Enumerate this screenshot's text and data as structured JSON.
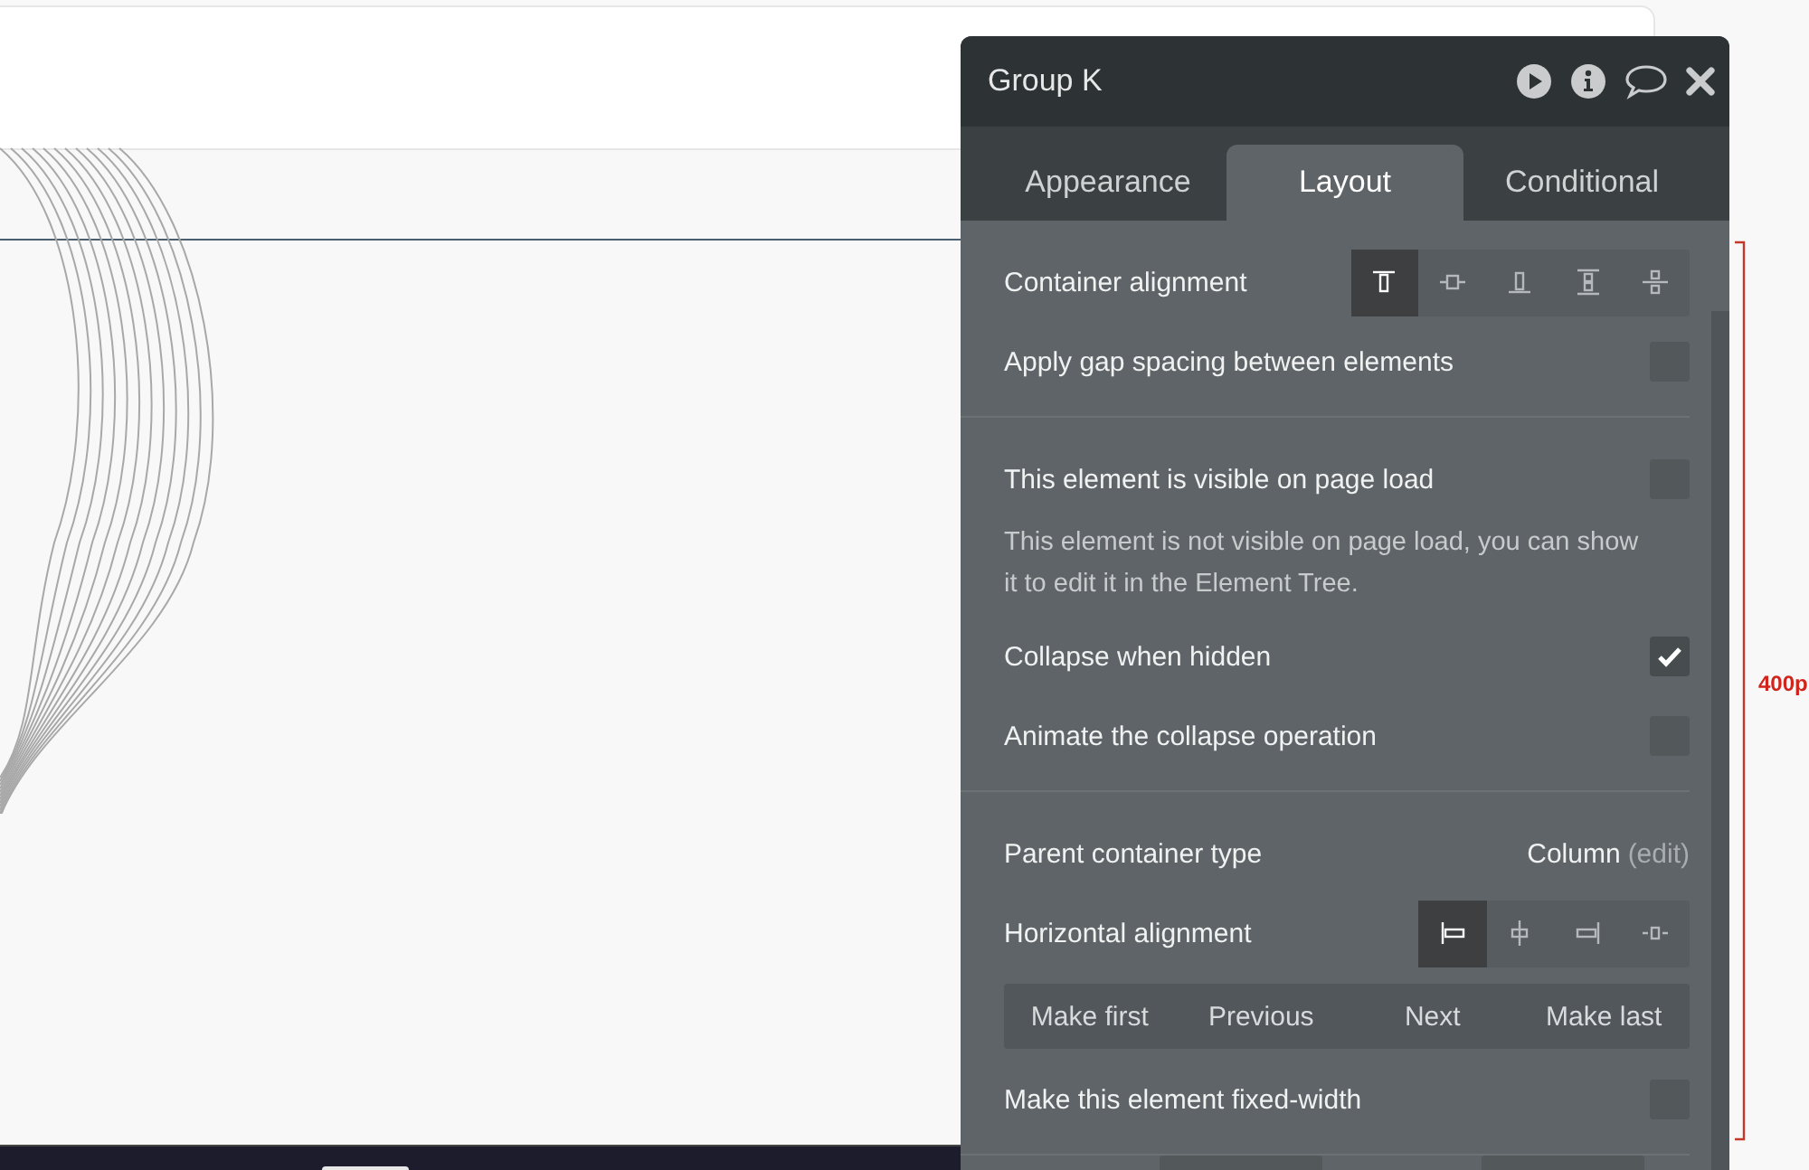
{
  "canvas": {
    "ruler_label": "400p"
  },
  "panel": {
    "title": "Group K",
    "tabs": [
      {
        "label": "Appearance",
        "selected": false
      },
      {
        "label": "Layout",
        "selected": true
      },
      {
        "label": "Conditional",
        "selected": false
      }
    ],
    "sections": [
      [
        {
          "kind": "alignment",
          "label": "Container alignment",
          "options": [
            {
              "selected": true
            },
            {
              "selected": false
            },
            {
              "selected": false
            },
            {
              "selected": false
            },
            {
              "selected": false
            }
          ]
        },
        {
          "kind": "checkbox",
          "label": "Apply gap spacing between elements",
          "checked": false
        }
      ],
      [
        {
          "kind": "checkbox",
          "label": "This element is visible on page load",
          "checked": false
        },
        {
          "kind": "note",
          "text": "This element is not visible on page load, you can show it to edit it in the Element Tree."
        },
        {
          "kind": "checkbox",
          "label": "Collapse when hidden",
          "checked": true
        },
        {
          "kind": "checkbox",
          "label": "Animate the collapse operation",
          "checked": false
        }
      ],
      [
        {
          "kind": "value",
          "label": "Parent container type",
          "value": "Column",
          "link": "(edit)"
        },
        {
          "kind": "alignment",
          "label": "Horizontal alignment",
          "options": [
            {
              "selected": true
            },
            {
              "selected": false
            },
            {
              "selected": false
            },
            {
              "selected": false
            }
          ]
        },
        {
          "kind": "buttons",
          "buttons": [
            "Make first",
            "Previous",
            "Next",
            "Make last"
          ]
        },
        {
          "kind": "checkbox",
          "label": "Make this element fixed-width",
          "checked": false
        }
      ]
    ]
  }
}
